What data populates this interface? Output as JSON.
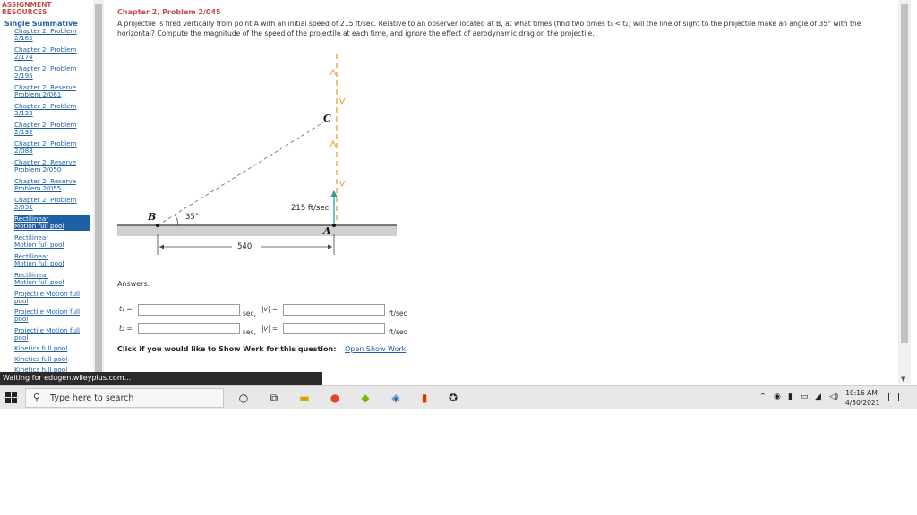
{
  "sidebar": {
    "heading_line1": "ASSIGNMENT",
    "heading_line2": "RESOURCES",
    "summative": "Single Summative",
    "items": [
      {
        "l1": "Chapter 2, Problem",
        "l2": "2/165"
      },
      {
        "l1": "Chapter 2, Problem",
        "l2": "2/174"
      },
      {
        "l1": "Chapter 2, Problem",
        "l2": "2/195"
      },
      {
        "l1": "Chapter 2, Reserve",
        "l2": "Problem 2/061"
      },
      {
        "l1": "Chapter 2, Problem",
        "l2": "2/122"
      },
      {
        "l1": "Chapter 2, Problem",
        "l2": "2/132"
      },
      {
        "l1": "Chapter 2, Problem",
        "l2": "2/088"
      },
      {
        "l1": "Chapter 2, Reserve",
        "l2": "Problem 2/050"
      },
      {
        "l1": "Chapter 2, Reserve",
        "l2": "Problem 2/055"
      },
      {
        "l1": "Chapter 2, Problem",
        "l2": "2/031"
      },
      {
        "l1": "Rectilinear",
        "l2": "Motion  full pool"
      },
      {
        "l1": "Rectilinear",
        "l2": "Motion  full pool"
      },
      {
        "l1": "Rectilinear",
        "l2": "Motion  full pool"
      },
      {
        "l1": "Rectilinear",
        "l2": "Motion  full pool"
      },
      {
        "l1": "Projectile Motion  full",
        "l2": "pool"
      },
      {
        "l1": "Projectile Motion  full",
        "l2": "pool"
      },
      {
        "l1": "Projectile Motion  full",
        "l2": "pool"
      },
      {
        "l1": "Kinetics  full pool",
        "l2": ""
      },
      {
        "l1": "Kinetics  full pool",
        "l2": ""
      },
      {
        "l1": "Kinetics  full pool",
        "l2": ""
      }
    ],
    "selected_index": 10
  },
  "problem": {
    "title": "Chapter 2, Problem 2/045",
    "text": "A projectile is fired vertically from point A with an initial speed of 215 ft/sec. Relative to an observer located at B, at what times (find two times t₁ < t₂) will the line of sight to the projectile make an angle of 35° with the horizontal? Compute the magnitude of the speed of the projectile at each time, and ignore the effect of aerodynamic drag on the projectile."
  },
  "figure": {
    "label_b": "B",
    "label_a": "A",
    "label_c": "C",
    "angle": "35°",
    "speed": "215 ft/sec",
    "distance": "540'"
  },
  "answers": {
    "label": "Answers:",
    "t1_label": "t₁ =",
    "t2_label": "t₂ =",
    "t1_value": "",
    "t2_value": "",
    "v1_value": "",
    "v2_value": "",
    "sec_unit": "sec,",
    "v_label": "|v| =",
    "speed_unit": "ft/sec",
    "show_work_prompt": "Click if you would like to Show Work for this question:",
    "show_work_link": "Open Show Work"
  },
  "status_bar": "Waiting for edugen.wileyplus.com...",
  "taskbar": {
    "search_placeholder": "Type here to search",
    "time": "10:16 AM",
    "date": "4/30/2021",
    "pinned_icons": [
      "cortana-icon",
      "task-view-icon",
      "file-explorer-icon",
      "chrome-icon",
      "nvidia-icon",
      "wireshark-icon",
      "office-icon",
      "steam-icon"
    ]
  }
}
